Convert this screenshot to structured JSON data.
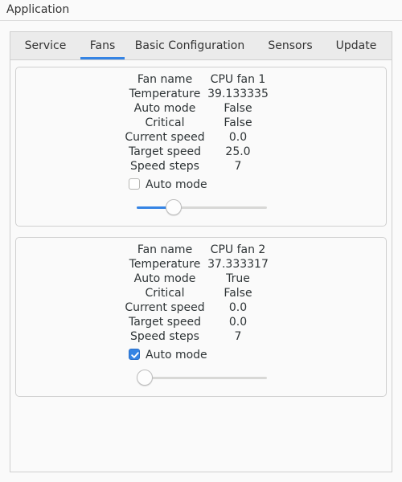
{
  "window": {
    "title": "Application"
  },
  "tabs": [
    {
      "label": "Service",
      "active": false
    },
    {
      "label": "Fans",
      "active": true
    },
    {
      "label": "Basic Configuration",
      "active": false
    },
    {
      "label": "Sensors",
      "active": false
    },
    {
      "label": "Update",
      "active": false
    }
  ],
  "colors": {
    "accent": "#3584e4"
  },
  "fans": [
    {
      "rows": [
        {
          "key": "Fan name",
          "value": "CPU fan 1"
        },
        {
          "key": "Temperature",
          "value": "39.133335"
        },
        {
          "key": "Auto mode",
          "value": "False"
        },
        {
          "key": "Critical",
          "value": "False"
        },
        {
          "key": "Current speed",
          "value": "0.0"
        },
        {
          "key": "Target speed",
          "value": "25.0"
        },
        {
          "key": "Speed steps",
          "value": "7"
        }
      ],
      "auto_mode_label": "Auto mode",
      "auto_mode_checked": false,
      "slider_fraction": 0.25
    },
    {
      "rows": [
        {
          "key": "Fan name",
          "value": "CPU fan 2"
        },
        {
          "key": "Temperature",
          "value": "37.333317"
        },
        {
          "key": "Auto mode",
          "value": "True"
        },
        {
          "key": "Critical",
          "value": "False"
        },
        {
          "key": "Current speed",
          "value": "0.0"
        },
        {
          "key": "Target speed",
          "value": "0.0"
        },
        {
          "key": "Speed steps",
          "value": "7"
        }
      ],
      "auto_mode_label": "Auto mode",
      "auto_mode_checked": true,
      "slider_fraction": 0.0
    }
  ]
}
